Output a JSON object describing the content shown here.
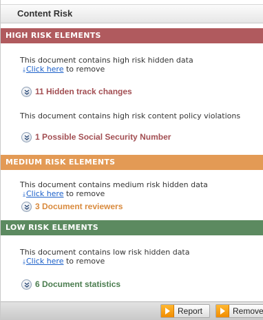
{
  "header": {
    "title": "Content Risk"
  },
  "high": {
    "title": "HIGH RISK ELEMENTS",
    "color": "#b05a5e",
    "hidden_msg": "This document contains high risk hidden data",
    "click_label": "Click here",
    "remove_suffix": " to remove",
    "item1": "11 Hidden track changes",
    "policy_msg": "This document contains high risk content policy violations",
    "item2": "1 Possible Social Security Number",
    "item_color": "#a24e52"
  },
  "medium": {
    "title": "MEDIUM RISK ELEMENTS",
    "color": "#e39a55",
    "hidden_msg": "This document contains medium risk hidden data",
    "click_label": "Click here",
    "remove_suffix": " to remove",
    "item1": "3 Document reviewers",
    "item_color": "#d98a3d"
  },
  "low": {
    "title": "LOW RISK ELEMENTS",
    "color": "#5c8a60",
    "hidden_msg": "This document contains low risk hidden data",
    "click_label": "Click here",
    "remove_suffix": " to remove",
    "item1": "6 Document statistics",
    "item_color": "#4b7d4f"
  },
  "footer": {
    "report_label": "Report",
    "remove_label": "Remove"
  },
  "icons": {
    "expand": "double-chevron-down-icon",
    "link_arrow": "download-arrow-icon",
    "button": "orange-arrow-icon"
  }
}
